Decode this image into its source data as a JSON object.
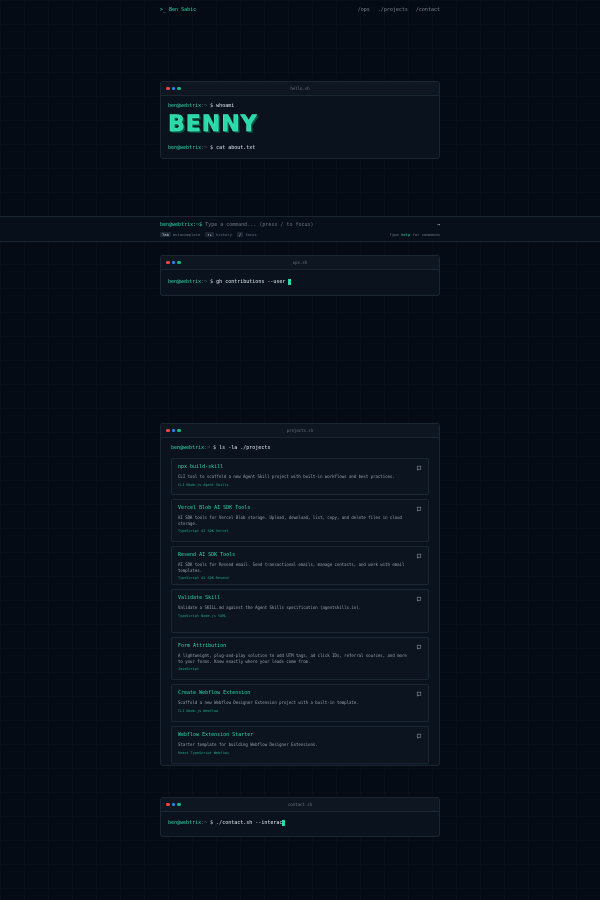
{
  "nav": {
    "brand_prefix": ">_",
    "brand_name": "Ben Sabic",
    "links": [
      "/ops",
      "./projects",
      "/contact"
    ]
  },
  "term_whoami": {
    "title": "hello.sh",
    "user": "ben@webtrix",
    "path": ":~",
    "dollar": "$",
    "cmd1": "whoami",
    "ascii": "BENNY",
    "cmd2": "cat about.txt"
  },
  "cmdbar": {
    "prompt": "ben@webtrix:~$",
    "placeholder": "Type a command... (press / to focus)",
    "arrow": "→",
    "hints": [
      {
        "key": "Tab",
        "label": "autocomplete"
      },
      {
        "key": "↑↓",
        "label": "history"
      },
      {
        "key": "/",
        "label": "focus"
      }
    ],
    "help_prefix": "Type",
    "help_word": "help",
    "help_suffix": "for commands"
  },
  "term_ops": {
    "title": "ops.sh",
    "user": "ben@webtrix",
    "path": ":~",
    "dollar": "$",
    "cmd": "gh contributions --user"
  },
  "term_projects": {
    "title": "projects.sh",
    "user": "ben@webtrix",
    "path": ":~",
    "dollar": "$",
    "cmd": "ls -la ./projects",
    "items": [
      {
        "name": "npx build-skill",
        "desc": "CLI tool to scaffold a new Agent Skill project with built-in workflows and best practices.",
        "tags": "CLI Node.js Agent Skills"
      },
      {
        "name": "Vercel Blob AI SDK Tools",
        "desc": "AI SDK tools for Vercel Blob storage. Upload, download, list, copy, and delete files in cloud storage.",
        "tags": "TypeScript AI SDK Vercel"
      },
      {
        "name": "Resend AI SDK Tools",
        "desc": "AI SDK tools for Resend email. Send transactional emails, manage contacts, and work with email templates.",
        "tags": "TypeScript AI SDK Resend"
      },
      {
        "name": "Validate Skill",
        "desc": "Validate a SKILL.md against the Agent Skills specification (agentskills.io).",
        "tags": "TypeScript Node.js YAML"
      },
      {
        "name": "Form Attribution",
        "desc": "A lightweight, plug-and-play solution to add UTM tags, ad click IDs, referral sources, and more to your forms. Know exactly where your leads come from.",
        "tags": "JavaScript"
      },
      {
        "name": "Create Webflow Extension",
        "desc": "Scaffold a new Webflow Designer Extension project with a built-in template.",
        "tags": "CLI Node.js Webflow"
      },
      {
        "name": "Webflow Extension Starter",
        "desc": "Starter template for building Webflow Designer Extensions.",
        "tags": "React TypeScript Webflow"
      }
    ]
  },
  "term_contact": {
    "title": "contact.sh",
    "user": "ben@webtrix",
    "path": ":~",
    "dollar": "$",
    "cmd": "./contact.sh --interac"
  },
  "colors": {
    "accent": "#2bd9a8",
    "background": "#050b14",
    "window": "#0a121d"
  }
}
